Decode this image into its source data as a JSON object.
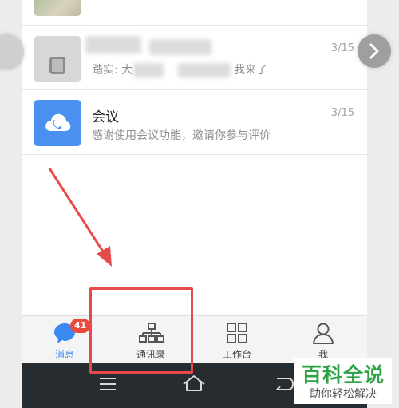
{
  "messages": {
    "row1": {
      "preview": "踏实: 大",
      "preview_tail": "我来了",
      "time": "3/15"
    },
    "meeting": {
      "title": "会议",
      "preview": "感谢使用会议功能，邀请你参与评价",
      "time": "3/15"
    }
  },
  "tabs": [
    {
      "label": "消息",
      "icon": "chat-bubble-icon",
      "badge": "41",
      "active": true
    },
    {
      "label": "通讯录",
      "icon": "org-chart-icon",
      "active": false
    },
    {
      "label": "工作台",
      "icon": "grid-icon",
      "active": false
    },
    {
      "label": "我",
      "icon": "person-icon",
      "active": false
    }
  ],
  "system_nav": [
    "menu-icon",
    "home-icon",
    "back-icon"
  ],
  "watermark": {
    "title": "百科全说",
    "subtitle": "助你轻松解决"
  },
  "colors": {
    "accent": "#3a89f0",
    "badge": "#e84a3c",
    "annotation": "#e84a4a",
    "watermark_green": "#2ea244",
    "system_bar": "#272c30"
  }
}
